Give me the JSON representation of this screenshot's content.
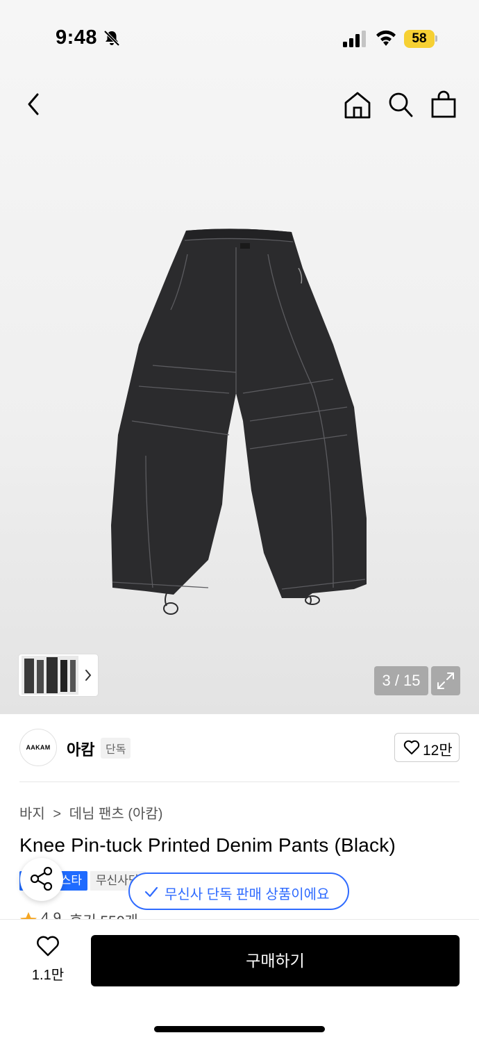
{
  "status": {
    "time": "9:48",
    "battery": "58"
  },
  "nav": {
    "back_icon": "chevron-left-icon",
    "home_icon": "home-icon",
    "search_icon": "search-icon",
    "bag_icon": "shopping-bag-icon"
  },
  "gallery": {
    "counter": "3 / 15",
    "current": 3,
    "total": 15
  },
  "brand": {
    "logo_text": "AAKAM",
    "name": "아캄",
    "tag": "단독",
    "likes": "12만"
  },
  "breadcrumb": {
    "category": "바지",
    "separator": ">",
    "subcategory": "데님 팬츠 (아캄)"
  },
  "product": {
    "title": "Knee Pin-tuck Printed Denim Pants (Black)"
  },
  "badges": {
    "blue": "스타",
    "gray": "무신사단"
  },
  "toast": {
    "text": "무신사 단독 판매 상품이에요"
  },
  "rating": {
    "score": "4.9",
    "reviews": "후기 550개"
  },
  "bottom": {
    "wish_count": "1.1만",
    "buy_label": "구매하기"
  },
  "colors": {
    "accent_blue": "#2f6bff",
    "battery_yellow": "#f6d033",
    "buy_black": "#000000",
    "star_orange": "#f5a623"
  }
}
